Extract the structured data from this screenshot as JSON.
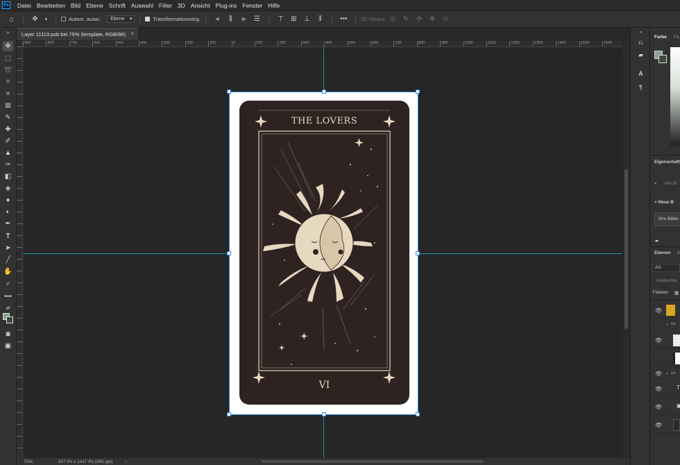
{
  "app": {
    "logo": "Ps"
  },
  "menu": [
    "Datei",
    "Bearbeiten",
    "Bild",
    "Ebene",
    "Schrift",
    "Auswahl",
    "Filter",
    "3D",
    "Ansicht",
    "Plug-ins",
    "Fenster",
    "Hilfe"
  ],
  "options": {
    "auto_select_label": "Autom. ausw.:",
    "auto_select_value": "Ebene",
    "transform_label": "Transformationsstrg.",
    "mode_3d_label": "3D-Modus:"
  },
  "document_tab": {
    "title": "Layer 11113.psb bei 75% (template, RGB/8#)"
  },
  "ruler_labels": [
    "900",
    "800",
    "700",
    "600",
    "500",
    "400",
    "300",
    "200",
    "100",
    "0",
    "100",
    "200",
    "300",
    "400",
    "500",
    "600",
    "700",
    "800",
    "900",
    "1000",
    "1100",
    "1200",
    "1300",
    "1400",
    "1500",
    "1600",
    "1700"
  ],
  "card": {
    "title": "THE LOVERS",
    "numeral": "VI",
    "colors": {
      "background": "#2e2321",
      "ink": "#e7d8c0",
      "canvas": "#ffffff"
    }
  },
  "status": {
    "zoom": "75%",
    "doc_info": "827 Px x 1417 Px (300 ppi)"
  },
  "panels": {
    "color_tab": "Farbe",
    "color_tab2": "Fa",
    "properties_tab": "Eigenschaft",
    "search_placeholder": "Alle Bi",
    "new_label": "+ Neue B",
    "library_label": "Ihre Biblio",
    "layers_tab": "Ebenen",
    "layers_tab2": "K",
    "layer_filter": "Art",
    "blend_mode": "Hindurchwi",
    "lock_label": "Fixieren:"
  },
  "accent": "#1fb8cc"
}
